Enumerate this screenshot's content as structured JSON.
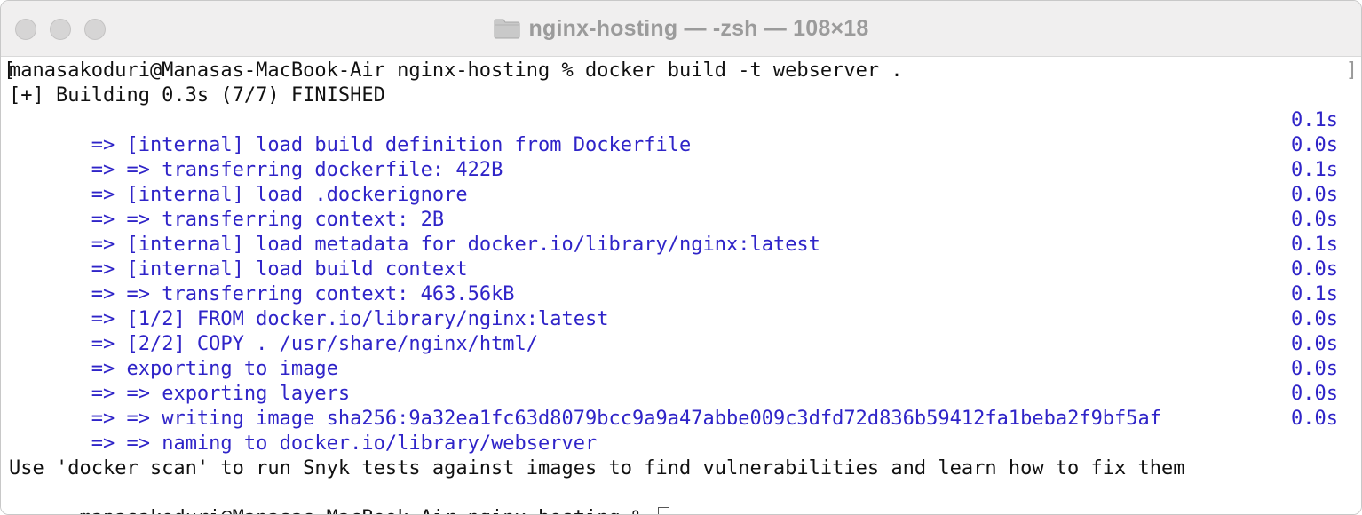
{
  "window": {
    "title": "nginx-hosting — -zsh — 108×18"
  },
  "terminal": {
    "command_line": "manasakoduri@Manasas-MacBook-Air nginx-hosting % docker build -t webserver .",
    "building_line": "[+] Building 0.3s (7/7) FINISHED",
    "steps": [
      {
        "text": " => [internal] load build definition from Dockerfile",
        "time": "0.1s"
      },
      {
        "text": " => => transferring dockerfile: 422B",
        "time": "0.0s"
      },
      {
        "text": " => [internal] load .dockerignore",
        "time": "0.1s"
      },
      {
        "text": " => => transferring context: 2B",
        "time": "0.0s"
      },
      {
        "text": " => [internal] load metadata for docker.io/library/nginx:latest",
        "time": "0.0s"
      },
      {
        "text": " => [internal] load build context",
        "time": "0.1s"
      },
      {
        "text": " => => transferring context: 463.56kB",
        "time": "0.0s"
      },
      {
        "text": " => [1/2] FROM docker.io/library/nginx:latest",
        "time": "0.1s"
      },
      {
        "text": " => [2/2] COPY . /usr/share/nginx/html/",
        "time": "0.0s"
      },
      {
        "text": " => exporting to image",
        "time": "0.0s"
      },
      {
        "text": " => => exporting layers",
        "time": "0.0s"
      },
      {
        "text": " => => writing image sha256:9a32ea1fc63d8079bcc9a9a47abbe009c3dfd72d836b59412fa1beba2f9bf5af",
        "time": "0.0s"
      },
      {
        "text": " => => naming to docker.io/library/webserver",
        "time": "0.0s"
      }
    ],
    "hint_line": "Use 'docker scan' to run Snyk tests against images to find vulnerabilities and learn how to fix them",
    "prompt_line": "manasakoduri@Manasas-MacBook-Air nginx-hosting % "
  },
  "colors": {
    "step_text": "#2f24c8",
    "default_text": "#111111",
    "titlebar": "#f0efef",
    "title_text": "#9b9b9b"
  },
  "icons": {
    "title_icon": "folder-icon"
  }
}
